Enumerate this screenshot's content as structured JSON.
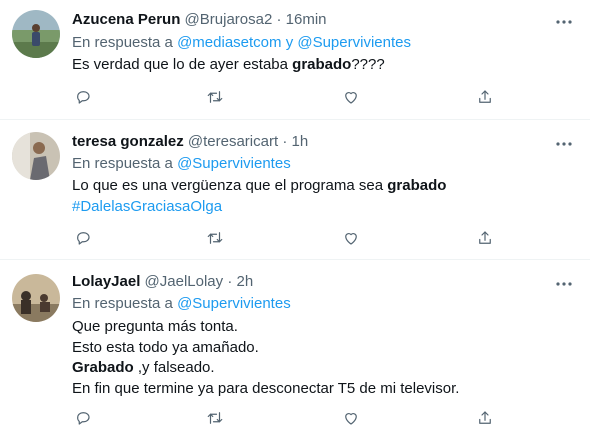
{
  "tweets": [
    {
      "name": "Azucena Perun",
      "handle": "@Brujarosa2",
      "dot": "·",
      "time": "16min",
      "reply_prefix": "En respuesta a",
      "reply_to": [
        "@mediasetcom",
        "y",
        "@Supervivientes"
      ],
      "lines": [
        {
          "pre": "Es verdad que lo de ayer estaba ",
          "bold": "grabado",
          "post": "????"
        }
      ]
    },
    {
      "name": "teresa gonzalez",
      "handle": "@teresaricart",
      "dot": "·",
      "time": "1h",
      "reply_prefix": "En respuesta a",
      "reply_to": [
        "@Supervivientes"
      ],
      "lines": [
        {
          "pre": "Lo que es una vergüenza que el programa sea ",
          "bold": "grabado",
          "post": ""
        }
      ],
      "hashtag": "#DalelasGraciasaOlga"
    },
    {
      "name": "LolayJael",
      "handle": "@JaelLolay",
      "dot": "·",
      "time": "2h",
      "reply_prefix": "En respuesta a",
      "reply_to": [
        "@Supervivientes"
      ],
      "lines": [
        {
          "pre": "Que pregunta más tonta.",
          "bold": "",
          "post": ""
        },
        {
          "pre": "Esto esta todo ya amañado.",
          "bold": "",
          "post": ""
        },
        {
          "pre": "",
          "bold": "Grabado",
          "post": " ,y falseado."
        },
        {
          "pre": "En fin que termine ya para desconectar T5 de mi televisor.",
          "bold": "",
          "post": ""
        }
      ]
    }
  ],
  "icons": {
    "more": "more-horizontal-icon",
    "reply": "reply-icon",
    "retweet": "retweet-icon",
    "like": "heart-icon",
    "share": "share-icon"
  },
  "colors": {
    "link": "#1d9bf0",
    "secondary": "#536471",
    "text": "#0f1419",
    "divider": "#eff3f4"
  }
}
